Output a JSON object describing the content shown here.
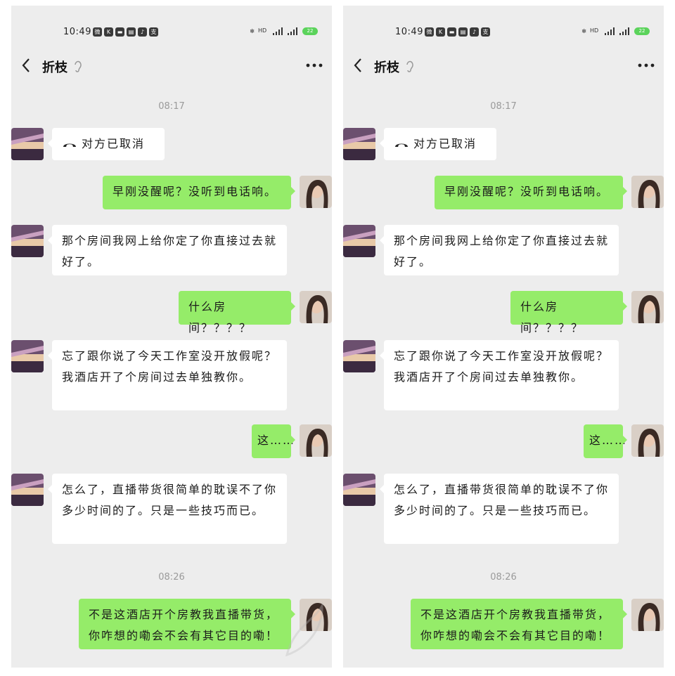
{
  "status": {
    "time": "10:49",
    "app_icons": [
      "微",
      "K",
      "▬",
      "▤",
      "♪",
      "支"
    ],
    "battery": "22"
  },
  "chat": {
    "title": "折枝",
    "timestamps": [
      "08:17",
      "08:26"
    ],
    "call_text": "对方已取消",
    "messages": [
      {
        "from": "me",
        "text": "早刚没醒呢？没听到电话响。"
      },
      {
        "from": "contact",
        "text": "那个房间我网上给你定了你直接过去就好了。"
      },
      {
        "from": "me",
        "text": "什么房间？？？？"
      },
      {
        "from": "contact",
        "text": "忘了跟你说了今天工作室没开放假呢？我酒店开了个房间过去单独教你。"
      },
      {
        "from": "me",
        "text": "这……"
      },
      {
        "from": "contact",
        "text": "怎么了，直播带货很简单的耽误不了你多少时间的了。只是一些技巧而已。"
      },
      {
        "from": "me",
        "text": "不是这酒店开个房教我直播带货，你咋想的嘞会不会有其它目的嘞！"
      }
    ]
  },
  "colors": {
    "background": "#ededed",
    "incoming_bubble": "#ffffff",
    "outgoing_bubble": "#95ec69",
    "timestamp": "#9a9a9a"
  }
}
